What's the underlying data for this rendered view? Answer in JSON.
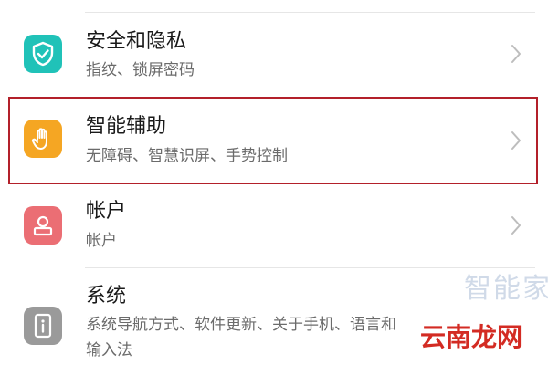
{
  "settings": {
    "items": [
      {
        "title": "安全和隐私",
        "subtitle": "指纹、锁屏密码",
        "icon": "shield-check-icon",
        "icon_color": "#20c2b8"
      },
      {
        "title": "智能辅助",
        "subtitle": "无障碍、智慧识屏、手势控制",
        "icon": "hand-icon",
        "icon_color": "#f5a623"
      },
      {
        "title": "帐户",
        "subtitle": "帐户",
        "icon": "account-icon",
        "icon_color": "#eb6e74"
      },
      {
        "title": "系统",
        "subtitle": "系统导航方式、软件更新、关于手机、语言和",
        "subtitle_line2": "输入法",
        "icon": "phone-info-icon",
        "icon_color": "#9a9a9a"
      }
    ]
  },
  "watermark": {
    "text": "智能家",
    "site": "云南龙网"
  },
  "colors": {
    "highlight_border": "#b3202a"
  }
}
